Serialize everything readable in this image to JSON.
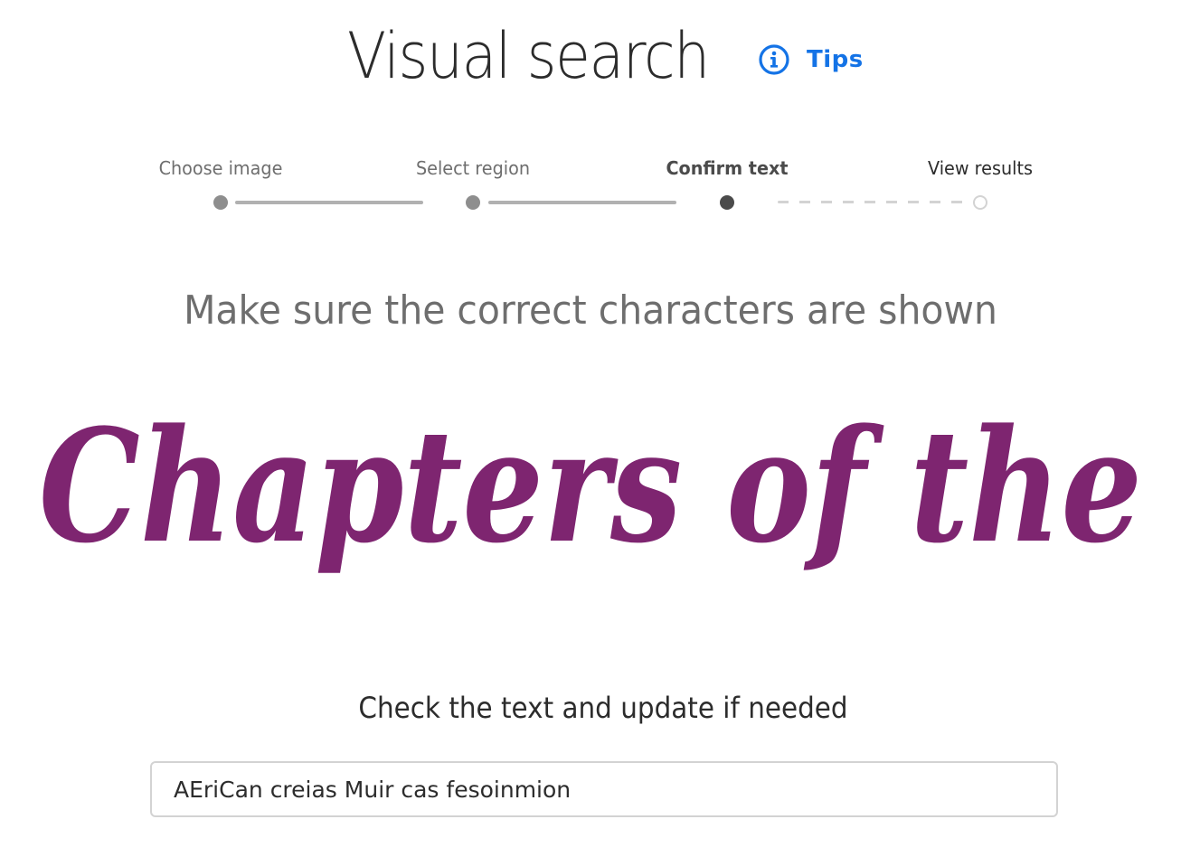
{
  "header": {
    "title": "Visual search",
    "tips_label": "Tips",
    "tips_icon": "info-icon",
    "accent_color": "#1473e6"
  },
  "stepper": {
    "steps": [
      {
        "label": "Choose image",
        "state": "done"
      },
      {
        "label": "Select region",
        "state": "done"
      },
      {
        "label": "Confirm text",
        "state": "active"
      },
      {
        "label": "View results",
        "state": "upcoming"
      }
    ]
  },
  "main": {
    "instruction": "Make sure the correct characters are shown",
    "image_text": "Chapters of the",
    "image_text_color": "#7e2570",
    "check_label": "Check the text and update if needed",
    "text_value": "AEriCan creias Muir cas fesoinmion"
  }
}
